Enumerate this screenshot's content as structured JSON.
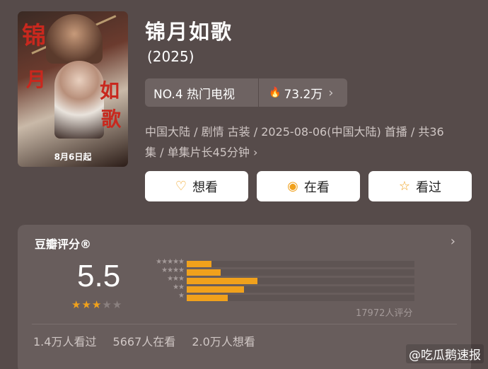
{
  "poster": {
    "calligraphy": [
      "锦",
      "月",
      "如",
      "歌"
    ],
    "release_text": "8月6日起"
  },
  "show": {
    "title": "锦月如歌",
    "year": "(2025)",
    "rank": "NO.4 热门电视",
    "hot_value": "73.2万",
    "meta_line1": "中国大陆 / 剧情 古装 / 2025-08-06(中国大陆) 首播 / 共36",
    "meta_line2": "集 / 单集片长45分钟"
  },
  "actions": {
    "want_label": "想看",
    "doing_label": "在看",
    "done_label": "看过"
  },
  "rating": {
    "label": "豆瓣评分®",
    "score": "5.5",
    "stars_filled": 3,
    "stars_total": 5,
    "total_count": "17972人评分",
    "distribution": [
      {
        "stars": "★★★★★",
        "fraction": 0.11
      },
      {
        "stars": "★★★★",
        "fraction": 0.15
      },
      {
        "stars": "★★★",
        "fraction": 0.31
      },
      {
        "stars": "★★",
        "fraction": 0.25
      },
      {
        "stars": "★",
        "fraction": 0.18
      }
    ],
    "stats": {
      "seen": "1.4万人看过",
      "watching": "5667人在看",
      "want": "2.0万人想看"
    }
  },
  "watermark": "@吃瓜鹅速报",
  "colors": {
    "background": "#564b4a",
    "accent": "#f0a11c",
    "card": "#685d5c"
  }
}
